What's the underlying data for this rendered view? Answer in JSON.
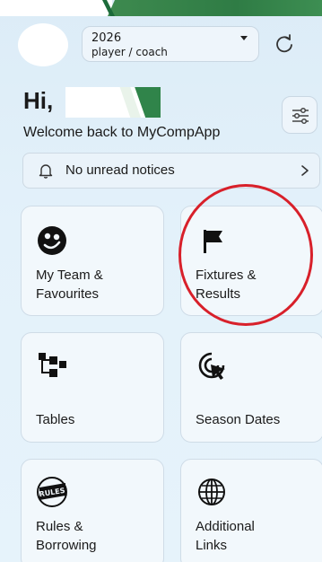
{
  "header": {
    "season": {
      "year": "2026",
      "role": "player / coach"
    }
  },
  "greeting": {
    "hi": "Hi,",
    "welcome": "Welcome back to MyCompApp"
  },
  "notices": {
    "text": "No unread notices"
  },
  "tiles": [
    {
      "label": "My Team &\nFavourites",
      "icon": "team-badge-icon"
    },
    {
      "label": "Fixtures &\nResults",
      "icon": "flag-icon"
    },
    {
      "label": "Tables",
      "icon": "hierarchy-icon"
    },
    {
      "label": "Season Dates",
      "icon": "cursor-click-icon"
    },
    {
      "label": "Rules &\nBorrowing",
      "icon": "rules-badge-icon"
    },
    {
      "label": "Additional\nLinks",
      "icon": "globe-icon"
    }
  ],
  "colors": {
    "accent_green": "#2f7c45",
    "annotation_red": "#d8202a",
    "background": "#e3f1fa"
  }
}
